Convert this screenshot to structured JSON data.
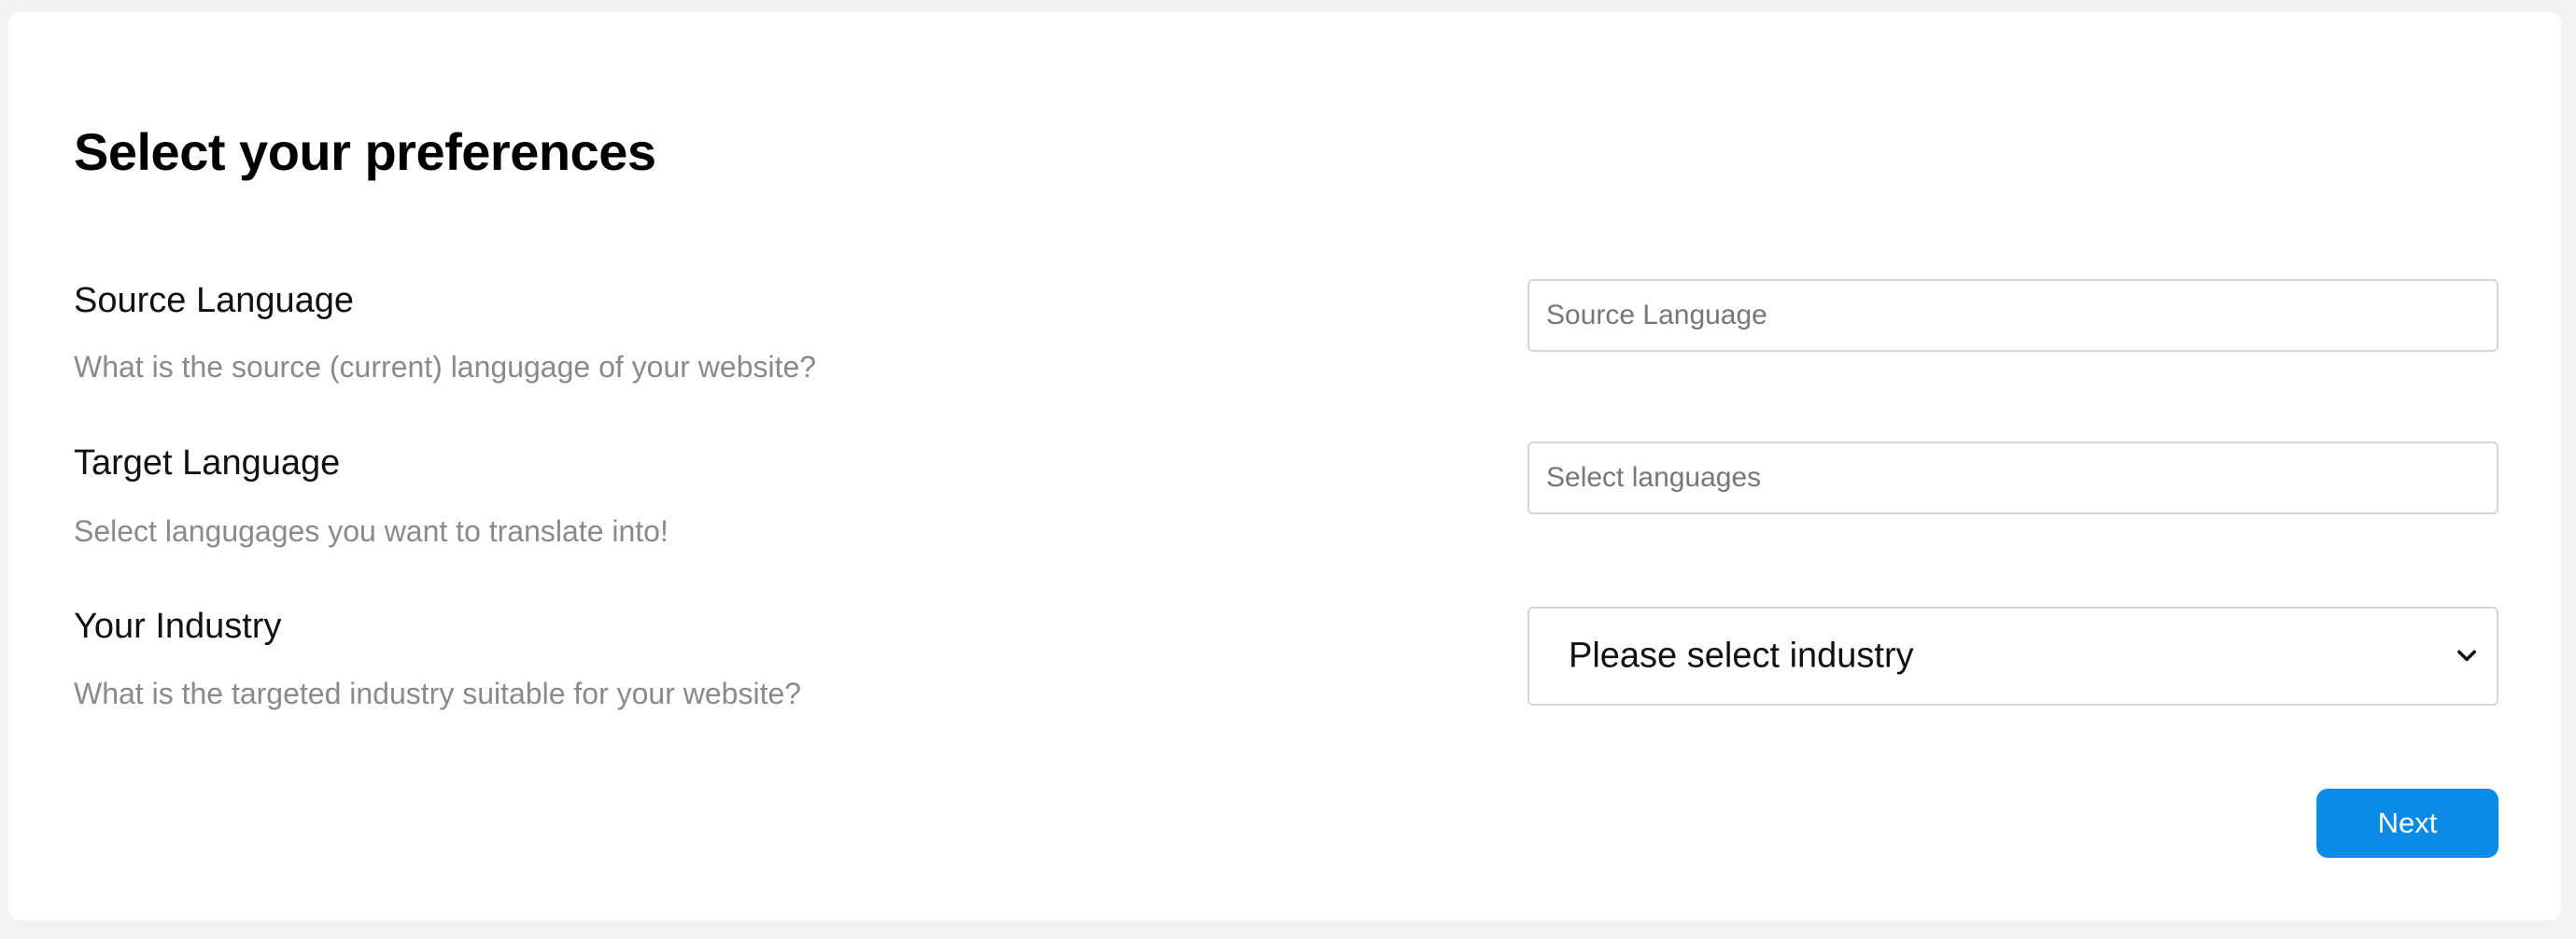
{
  "page": {
    "title": "Select your preferences"
  },
  "fields": {
    "source_language": {
      "label": "Source Language",
      "description": "What is the source (current) langugage of your website?",
      "placeholder": "Source Language",
      "value": ""
    },
    "target_language": {
      "label": "Target Language",
      "description": "Select langugages you want to translate into!",
      "placeholder": "Select languages",
      "value": ""
    },
    "industry": {
      "label": "Your Industry",
      "description": "What is the targeted industry suitable for your website?",
      "selected": "Please select industry",
      "icon": "chevron-down-icon"
    }
  },
  "actions": {
    "next_label": "Next"
  },
  "colors": {
    "accent": "#0b8be6",
    "background": "#f3f3f3",
    "card": "#ffffff",
    "muted_text": "#8a8a8a"
  }
}
